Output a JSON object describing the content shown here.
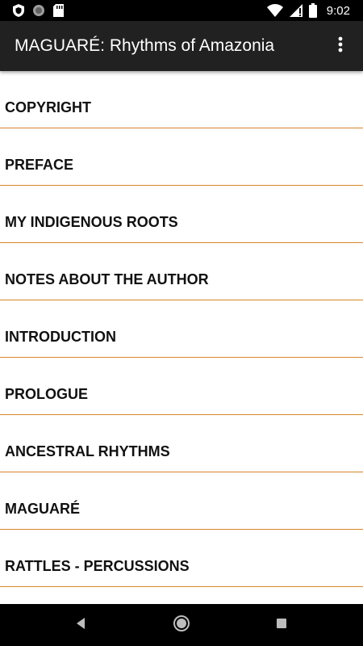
{
  "status_bar": {
    "time": "9:02",
    "left_icons": [
      "shield-icon",
      "sync-circle-icon",
      "sd-card-icon"
    ],
    "right_icons": [
      "wifi-icon",
      "cellular-signal-icon",
      "battery-icon"
    ]
  },
  "app_bar": {
    "title": "MAGUARÉ: Rhythms of Amazonia",
    "overflow_icon": "more-vert-icon"
  },
  "chapters": [
    {
      "label": "COPYRIGHT"
    },
    {
      "label": "PREFACE"
    },
    {
      "label": "MY INDIGENOUS ROOTS"
    },
    {
      "label": "NOTES ABOUT THE AUTHOR"
    },
    {
      "label": "INTRODUCTION"
    },
    {
      "label": "PROLOGUE"
    },
    {
      "label": "ANCESTRAL RHYTHMS"
    },
    {
      "label": "MAGUARÉ"
    },
    {
      "label": "RATTLES - PERCUSSIONS"
    }
  ],
  "nav_bar": {
    "icons": [
      "back-icon",
      "home-icon",
      "recents-icon"
    ]
  },
  "colors": {
    "app_bar": "#212121",
    "divider": "#d9862b",
    "status_bar": "#000000"
  }
}
